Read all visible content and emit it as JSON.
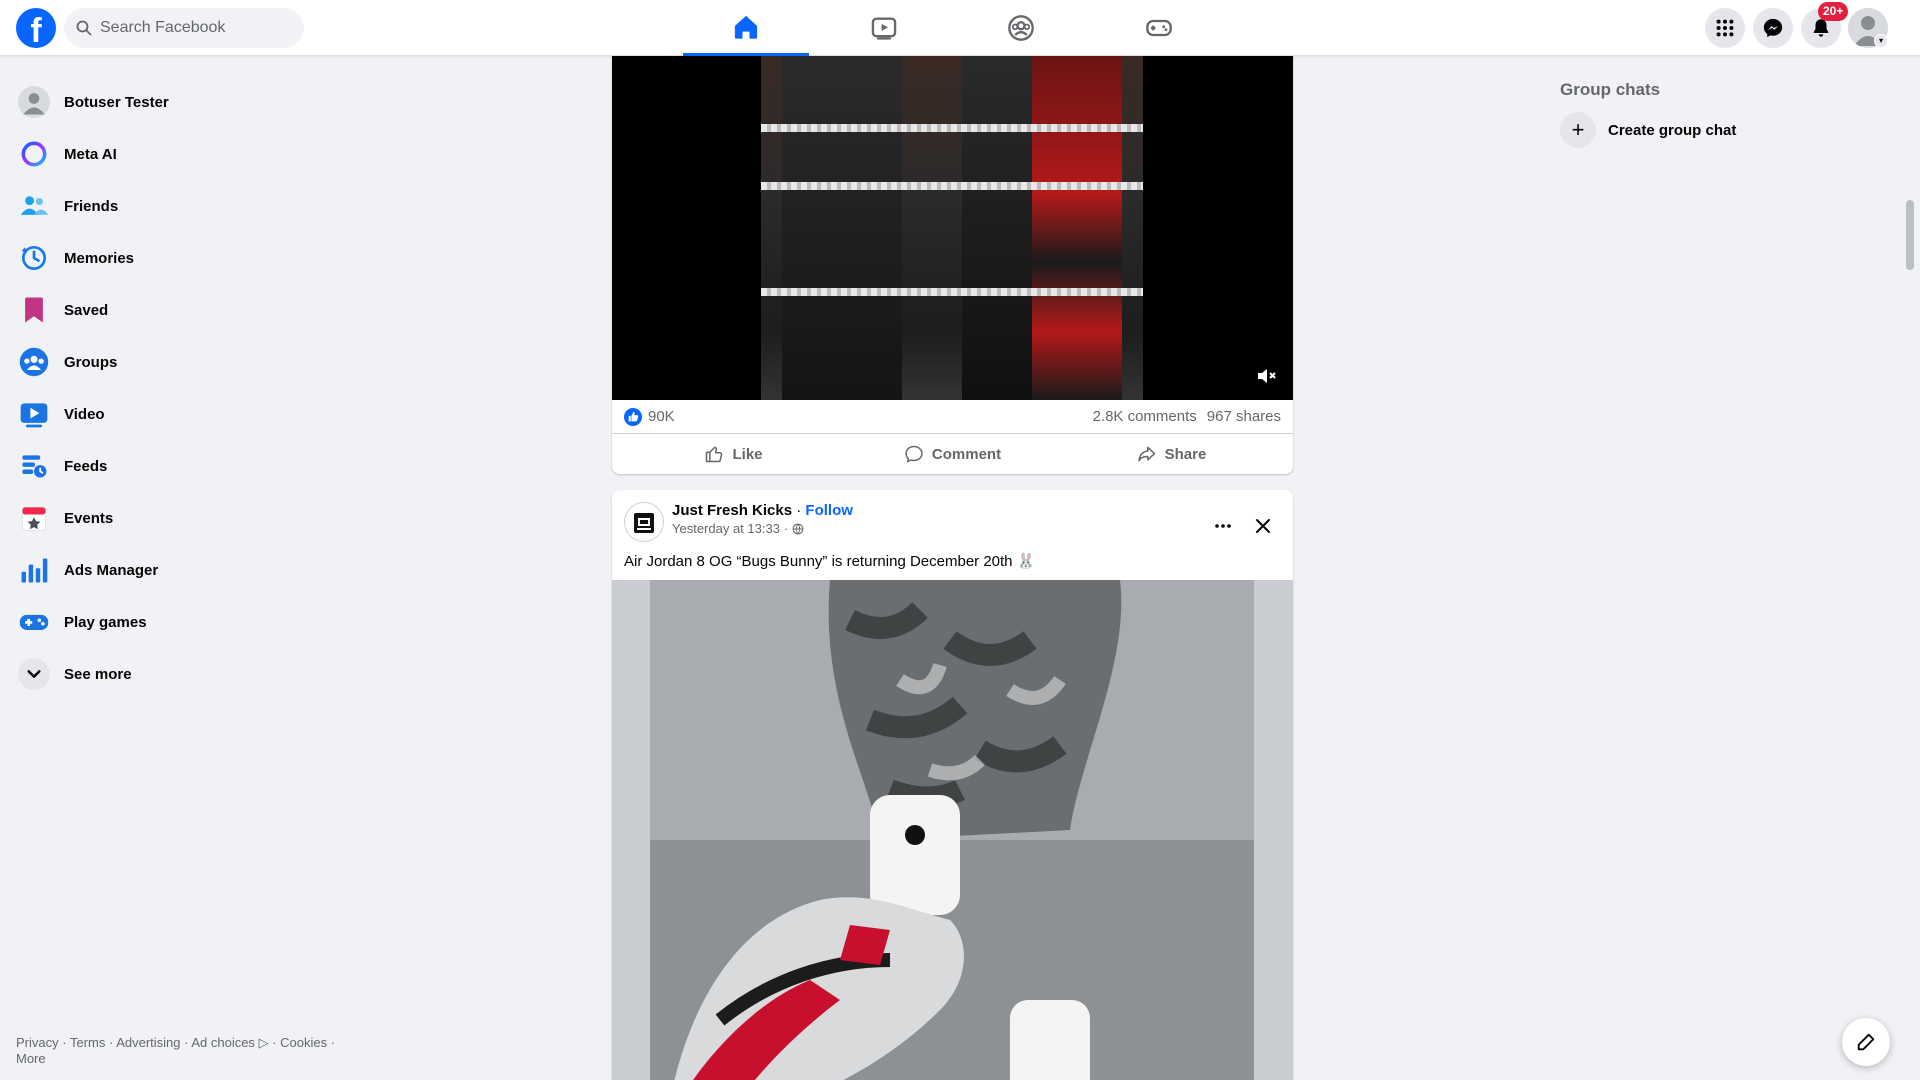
{
  "header": {
    "logo": "f",
    "search_placeholder": "Search Facebook",
    "notification_badge": "20+",
    "tabs": [
      "home",
      "video",
      "groups",
      "gaming"
    ],
    "active_tab": "home"
  },
  "left_nav": {
    "items": [
      {
        "label": "Botuser Tester",
        "icon": "profile-icon"
      },
      {
        "label": "Meta AI",
        "icon": "meta-ai-icon"
      },
      {
        "label": "Friends",
        "icon": "friends-icon"
      },
      {
        "label": "Memories",
        "icon": "memories-icon"
      },
      {
        "label": "Saved",
        "icon": "saved-icon"
      },
      {
        "label": "Groups",
        "icon": "groups-icon"
      },
      {
        "label": "Video",
        "icon": "video-icon"
      },
      {
        "label": "Feeds",
        "icon": "feeds-icon"
      },
      {
        "label": "Events",
        "icon": "events-icon"
      },
      {
        "label": "Ads Manager",
        "icon": "ads-manager-icon"
      },
      {
        "label": "Play games",
        "icon": "play-games-icon"
      },
      {
        "label": "See more",
        "icon": "chevron-down-icon"
      }
    ]
  },
  "footer": {
    "privacy": "Privacy",
    "terms": "Terms",
    "advertising": "Advertising",
    "ad_choices": "Ad choices",
    "cookies": "Cookies",
    "more": "More"
  },
  "post1": {
    "reactions": "90K",
    "comments": "2.8K comments",
    "shares": "967 shares",
    "like_label": "Like",
    "comment_label": "Comment",
    "share_label": "Share"
  },
  "post2": {
    "page_name": "Just Fresh Kicks",
    "follow_label": "Follow",
    "timestamp": "Yesterday at 13:33",
    "text": "Air Jordan 8 OG “Bugs Bunny” is returning December 20th 🐰"
  },
  "right_col": {
    "title": "Group chats",
    "create_label": "Create group chat"
  },
  "colors": {
    "brand": "#0866ff",
    "badge": "#e41e3f",
    "background": "#f0f2f5"
  }
}
